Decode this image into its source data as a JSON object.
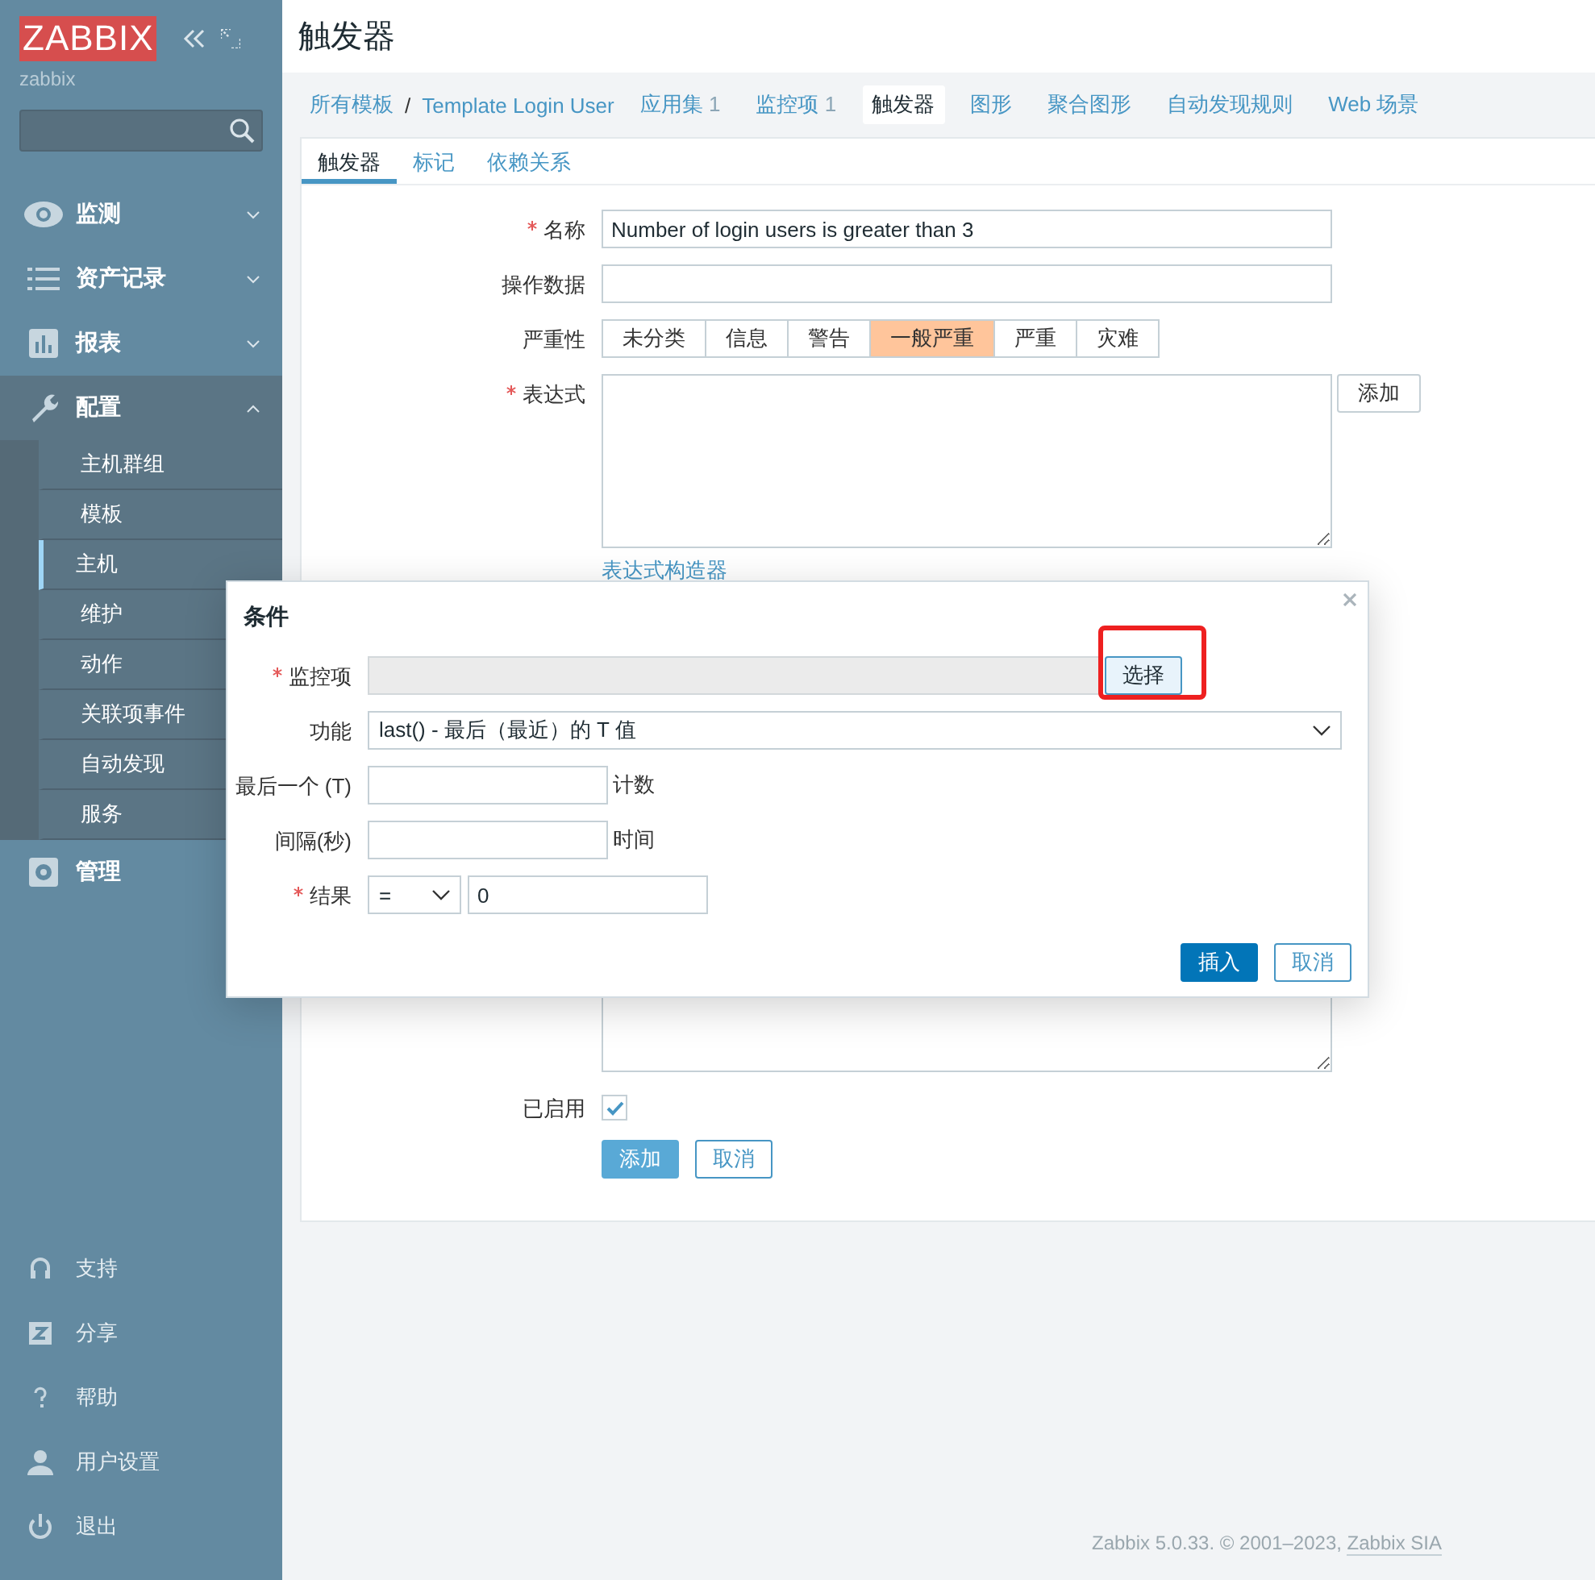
{
  "sidebar": {
    "logo": "ZABBIX",
    "server_name": "zabbix",
    "menu": [
      {
        "label": "监测",
        "expanded": false
      },
      {
        "label": "资产记录",
        "expanded": false
      },
      {
        "label": "报表",
        "expanded": false
      },
      {
        "label": "配置",
        "expanded": true,
        "children": [
          {
            "label": "主机群组",
            "selected": false
          },
          {
            "label": "模板",
            "selected": false
          },
          {
            "label": "主机",
            "selected": true
          },
          {
            "label": "维护",
            "selected": false
          },
          {
            "label": "动作",
            "selected": false
          },
          {
            "label": "关联项事件",
            "selected": false
          },
          {
            "label": "自动发现",
            "selected": false
          },
          {
            "label": "服务",
            "selected": false
          }
        ]
      },
      {
        "label": "管理",
        "expanded": false
      }
    ],
    "bottom_menu": [
      {
        "label": "支持"
      },
      {
        "label": "分享"
      },
      {
        "label": "帮助"
      },
      {
        "label": "用户设置"
      },
      {
        "label": "退出"
      }
    ]
  },
  "header": {
    "title": "触发器"
  },
  "breadcrumb": [
    {
      "label": "所有模板"
    },
    {
      "label": "Template Login User"
    }
  ],
  "breadcrumb_separator": "/",
  "nav_tabs": [
    {
      "label": "应用集",
      "count": "1",
      "selected": false
    },
    {
      "label": "监控项",
      "count": "1",
      "selected": false
    },
    {
      "label": "触发器",
      "selected": true
    },
    {
      "label": "图形",
      "selected": false
    },
    {
      "label": "聚合图形",
      "selected": false
    },
    {
      "label": "自动发现规则",
      "selected": false
    },
    {
      "label": "Web 场景",
      "selected": false
    }
  ],
  "form_tabs": [
    {
      "label": "触发器",
      "selected": true
    },
    {
      "label": "标记",
      "selected": false
    },
    {
      "label": "依赖关系",
      "selected": false
    }
  ],
  "form": {
    "name": {
      "label": "名称",
      "required": true,
      "value": "Number of login users is greater than 3"
    },
    "operational_data": {
      "label": "操作数据",
      "required": false
    },
    "severity": {
      "label": "严重性",
      "options": [
        {
          "label": "未分类",
          "selected": false
        },
        {
          "label": "信息",
          "selected": false
        },
        {
          "label": "警告",
          "selected": false
        },
        {
          "label": "一般严重",
          "selected": true
        },
        {
          "label": "严重",
          "selected": false
        },
        {
          "label": "灾难",
          "selected": false
        }
      ]
    },
    "expression": {
      "label": "表达式",
      "required": true,
      "add_button": "添加",
      "builder_link": "表达式构造器"
    },
    "enabled": {
      "label": "已启用",
      "checked": true
    },
    "buttons": [
      {
        "label": "添加",
        "kind": "primary"
      },
      {
        "label": "取消",
        "kind": "secondary"
      }
    ]
  },
  "dialog": {
    "title": "条件",
    "fields": [
      {
        "kind": "picker",
        "label": "监控项",
        "required": true,
        "button": "选择",
        "highlighted": true
      },
      {
        "kind": "select",
        "label": "功能",
        "required": false,
        "value": "last() - 最后（最近）的 T 值"
      },
      {
        "kind": "input",
        "label": "最后一个 (T)",
        "required": false,
        "suffix": "计数"
      },
      {
        "kind": "input",
        "label": "间隔(秒)",
        "required": false,
        "suffix": "时间"
      },
      {
        "kind": "result",
        "label": "结果",
        "required": true,
        "operator": "=",
        "value": "0"
      }
    ],
    "buttons": [
      {
        "label": "插入",
        "kind": "primary"
      },
      {
        "label": "取消",
        "kind": "secondary"
      }
    ]
  },
  "footer": {
    "text": "Zabbix 5.0.33. © 2001–2023, ",
    "link": "Zabbix SIA"
  }
}
